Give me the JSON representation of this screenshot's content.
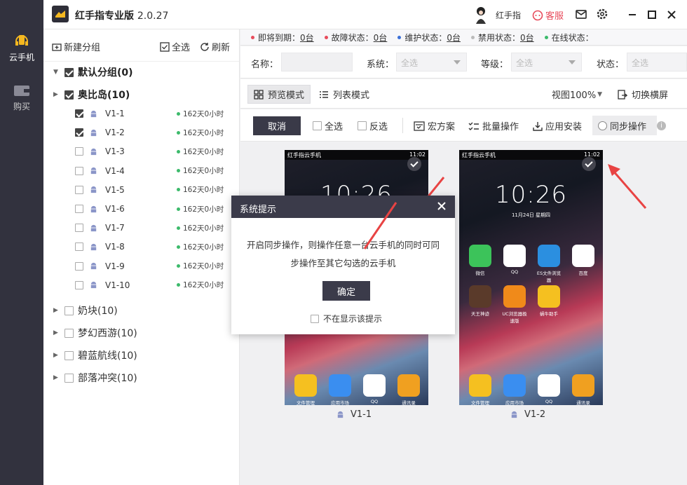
{
  "rail": {
    "items": [
      {
        "label": "云手机",
        "icon": "phone-cloud-icon",
        "active": true
      },
      {
        "label": "购买",
        "icon": "wallet-icon",
        "active": false
      }
    ]
  },
  "titlebar": {
    "app_name": "红手指专业版",
    "version": "2.0.27",
    "user_name": "红手指",
    "service_label": "客服"
  },
  "sidebar": {
    "new_group": "新建分组",
    "select_all": "全选",
    "refresh": "刷新",
    "groups": [
      {
        "label": "默认分组(0)",
        "expanded": true,
        "checked": true
      },
      {
        "label": "奥比岛(10)",
        "expanded": true,
        "checked": true
      },
      {
        "label": "奶块(10)",
        "expanded": false,
        "checked": false
      },
      {
        "label": "梦幻西游(10)",
        "expanded": false,
        "checked": false
      },
      {
        "label": "碧蓝航线(10)",
        "expanded": false,
        "checked": false
      },
      {
        "label": "部落冲突(10)",
        "expanded": false,
        "checked": false
      }
    ],
    "devices": [
      {
        "name": "V1-1",
        "time": "162天0小时",
        "checked": true
      },
      {
        "name": "V1-2",
        "time": "162天0小时",
        "checked": true
      },
      {
        "name": "V1-3",
        "time": "162天0小时",
        "checked": false
      },
      {
        "name": "V1-4",
        "time": "162天0小时",
        "checked": false
      },
      {
        "name": "V1-5",
        "time": "162天0小时",
        "checked": false
      },
      {
        "name": "V1-6",
        "time": "162天0小时",
        "checked": false
      },
      {
        "name": "V1-7",
        "time": "162天0小时",
        "checked": false
      },
      {
        "name": "V1-8",
        "time": "162天0小时",
        "checked": false
      },
      {
        "name": "V1-9",
        "time": "162天0小时",
        "checked": false
      },
      {
        "name": "V1-10",
        "time": "162天0小时",
        "checked": false
      }
    ]
  },
  "statusbar": {
    "items": [
      {
        "label": "即将到期：",
        "value": "0台",
        "color": "#e84b5b"
      },
      {
        "label": "故障状态：",
        "value": "0台",
        "color": "#e84b5b"
      },
      {
        "label": "维护状态：",
        "value": "0台",
        "color": "#3a6fd8"
      },
      {
        "label": "禁用状态：",
        "value": "0台",
        "color": "#bbbbbb"
      },
      {
        "label": "在线状态：",
        "value": "",
        "color": "#3cba6b"
      }
    ]
  },
  "filters": {
    "name_label": "名称：",
    "system_label": "系统：",
    "system_value": "全选",
    "level_label": "等级：",
    "level_value": "全选",
    "state_label": "状态：",
    "state_value": "全选"
  },
  "viewbar": {
    "preview_mode": "预览模式",
    "list_mode": "列表模式",
    "zoom": "视图100%",
    "landscape": "切换横屏"
  },
  "actionbar": {
    "cancel": "取消",
    "select_all": "全选",
    "invert": "反选",
    "macro": "宏方案",
    "batch": "批量操作",
    "install": "应用安装",
    "sync": "同步操作"
  },
  "phones": [
    {
      "label": "V1-1",
      "status_title": "红手指云手机",
      "clock": "10:26",
      "status_time": "11:02"
    },
    {
      "label": "V1-2",
      "status_title": "红手指云手机",
      "clock": "10:26",
      "date": "11月24日 星期四",
      "status_time": "11:02",
      "apps": [
        {
          "name": "微信",
          "color": "#3cc35a"
        },
        {
          "name": "QQ",
          "color": "#ffffff"
        },
        {
          "name": "ES文件浏览器",
          "color": "#2b8fe0"
        },
        {
          "name": "百度",
          "color": "#ffffff"
        },
        {
          "name": "天王神迹",
          "color": "#5a3a2a"
        },
        {
          "name": "UC浏览器极速版",
          "color": "#f08a1a"
        },
        {
          "name": "蜗牛助手",
          "color": "#f5c020"
        }
      ]
    }
  ],
  "dock": [
    {
      "name": "文件管理",
      "color": "#f5c020"
    },
    {
      "name": "应用市场",
      "color": "#3a8ef0"
    },
    {
      "name": "QQ Browser",
      "color": "#ffffff"
    },
    {
      "name": "通讯录",
      "color": "#f0a020"
    }
  ],
  "modal": {
    "title": "系统提示",
    "message": "开启同步操作，则操作任意一台云手机的同时可同步操作至其它勾选的云手机",
    "ok": "确定",
    "no_more": "不在显示该提示"
  }
}
